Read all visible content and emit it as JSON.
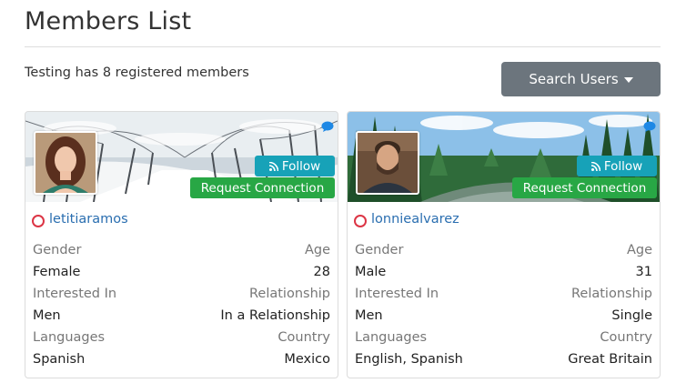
{
  "page": {
    "title": "Members List",
    "member_count_text": "Testing has 8 registered members",
    "search_button_label": "Search Users"
  },
  "colors": {
    "primary_link": "#2a6eb0",
    "follow_button": "#17a2b8",
    "connect_button": "#28a745",
    "search_button": "#6c757d",
    "status_offline": "#dc3545"
  },
  "members": [
    {
      "username": "letitiaramos",
      "follow_label": "Follow",
      "connect_label": "Request Connection",
      "status": "offline",
      "labels": {
        "gender": "Gender",
        "age": "Age",
        "interested_in": "Interested In",
        "relationship": "Relationship",
        "languages": "Languages",
        "country": "Country"
      },
      "gender": "Female",
      "age": "28",
      "interested_in": "Men",
      "relationship": "In a Relationship",
      "languages": "Spanish",
      "country": "Mexico"
    },
    {
      "username": "lonniealvarez",
      "follow_label": "Follow",
      "connect_label": "Request Connection",
      "status": "offline",
      "labels": {
        "gender": "Gender",
        "age": "Age",
        "interested_in": "Interested In",
        "relationship": "Relationship",
        "languages": "Languages",
        "country": "Country"
      },
      "gender": "Male",
      "age": "31",
      "interested_in": "Men",
      "relationship": "Single",
      "languages": "English, Spanish",
      "country": "Great Britain"
    }
  ]
}
